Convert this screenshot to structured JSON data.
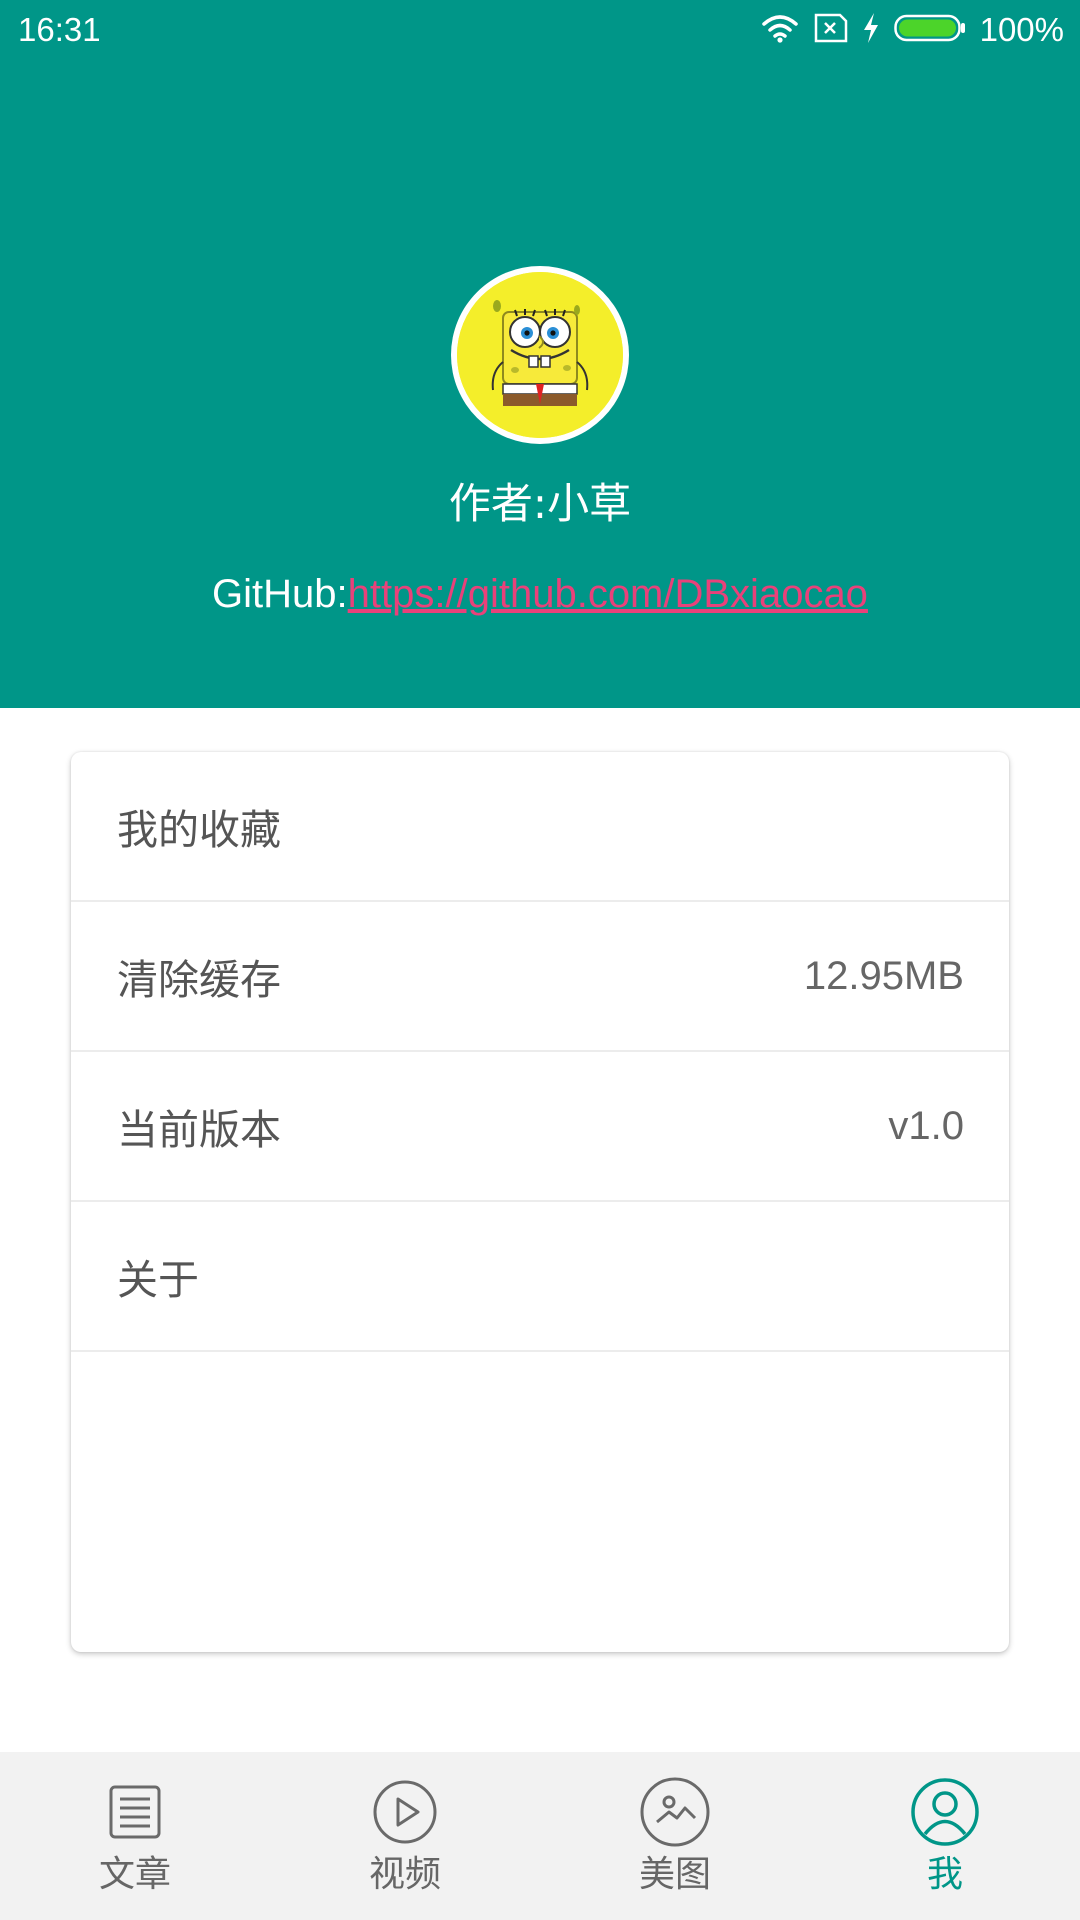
{
  "status_bar": {
    "time": "16:31",
    "battery_percent": "100%",
    "icons": [
      "wifi-icon",
      "sim-off-icon",
      "charging-icon",
      "battery-icon"
    ]
  },
  "profile": {
    "avatar_icon": "spongebob-avatar-icon",
    "author": "作者:小草",
    "github_prefix": "GitHub:",
    "github_url": "https://github.com/DBxiaocao"
  },
  "settings": {
    "items": [
      {
        "label": "我的收藏",
        "value": ""
      },
      {
        "label": "清除缓存",
        "value": "12.95MB"
      },
      {
        "label": "当前版本",
        "value": "v1.0"
      },
      {
        "label": "关于",
        "value": ""
      }
    ]
  },
  "bottom_nav": {
    "items": [
      {
        "label": "文章",
        "icon": "article-icon"
      },
      {
        "label": "视频",
        "icon": "play-icon"
      },
      {
        "label": "美图",
        "icon": "image-icon"
      },
      {
        "label": "我",
        "icon": "person-icon"
      }
    ],
    "active": "我"
  },
  "colors": {
    "primary": "#009688",
    "link": "#e9417a",
    "battery": "#4cd42a",
    "avatar_bg": "#f4ee2a",
    "nav_bg": "#f2f2f2"
  }
}
